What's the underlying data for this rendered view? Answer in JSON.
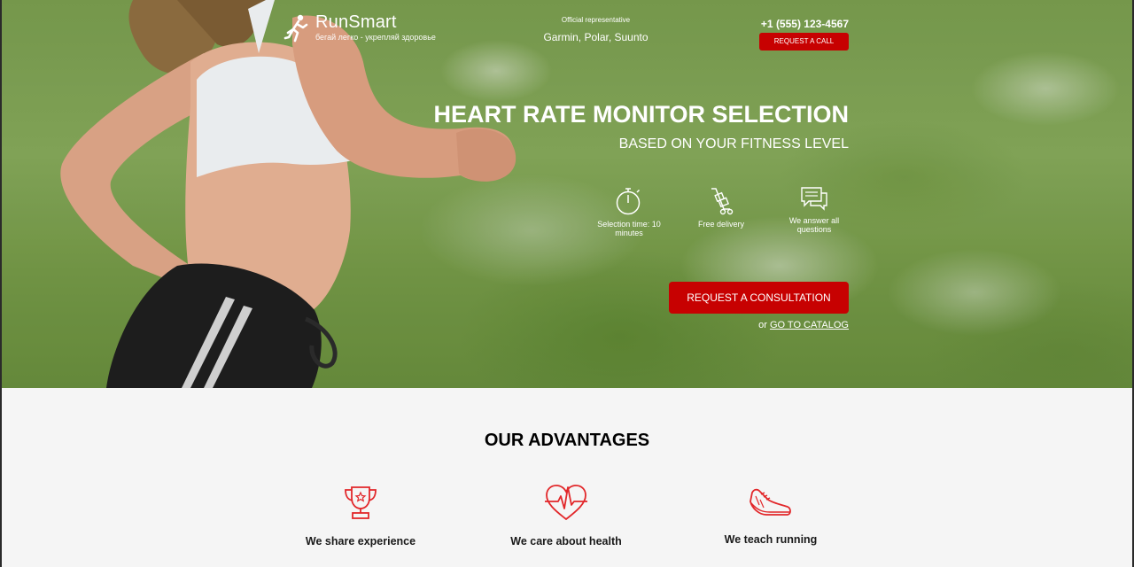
{
  "header": {
    "brand": "RunSmart",
    "tagline": "бегай легко - укрепляй здоровье",
    "official_label": "Official representative",
    "official_brands": "Garmin, Polar, Suunto",
    "phone": "+1 (555) 123-4567",
    "request_call_label": "REQUEST A CALL"
  },
  "hero": {
    "title": "HEART RATE MONITOR SELECTION",
    "subtitle": "BASED ON YOUR FITNESS LEVEL",
    "features": [
      {
        "icon": "stopwatch-icon",
        "label": "Selection time: 10 minutes"
      },
      {
        "icon": "delivery-cart-icon",
        "label": "Free delivery"
      },
      {
        "icon": "chat-bubbles-icon",
        "label": "We answer all questions"
      }
    ],
    "consult_label": "REQUEST A CONSULTATION",
    "catalog_prefix": "or",
    "catalog_link": "GO TO CATALOG"
  },
  "advantages": {
    "title": "OUR ADVANTAGES",
    "items": [
      {
        "icon": "trophy-icon",
        "label": "We share experience"
      },
      {
        "icon": "heart-pulse-icon",
        "label": "We care about health"
      },
      {
        "icon": "running-shoe-icon",
        "label": "We teach running"
      }
    ]
  },
  "colors": {
    "accent": "#c70101",
    "icon_red": "#e2272a",
    "section_bg": "#f5f5f5"
  }
}
